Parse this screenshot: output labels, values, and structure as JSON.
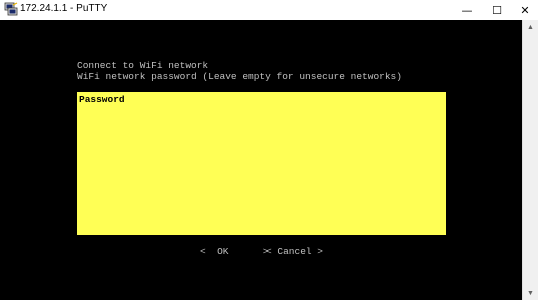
{
  "window": {
    "title": "172.24.1.1 - PuTTY",
    "app_icon": "putty-icon",
    "controls": {
      "minimize": "—",
      "maximize": "☐",
      "close": "✕"
    }
  },
  "terminal": {
    "heading": "Connect to WiFi network",
    "prompt": "WiFi network password (Leave empty for unsecure networks)",
    "input_label": "Password",
    "input_value": "",
    "ok_button": "<  OK      >",
    "cancel_button": "< Cancel >",
    "colors": {
      "background": "#000000",
      "text": "#c0c0c0",
      "input_bg": "#ffff55"
    }
  },
  "scrollbar": {
    "up_icon": "scroll-up-arrow-icon",
    "down_icon": "scroll-down-arrow-icon"
  }
}
